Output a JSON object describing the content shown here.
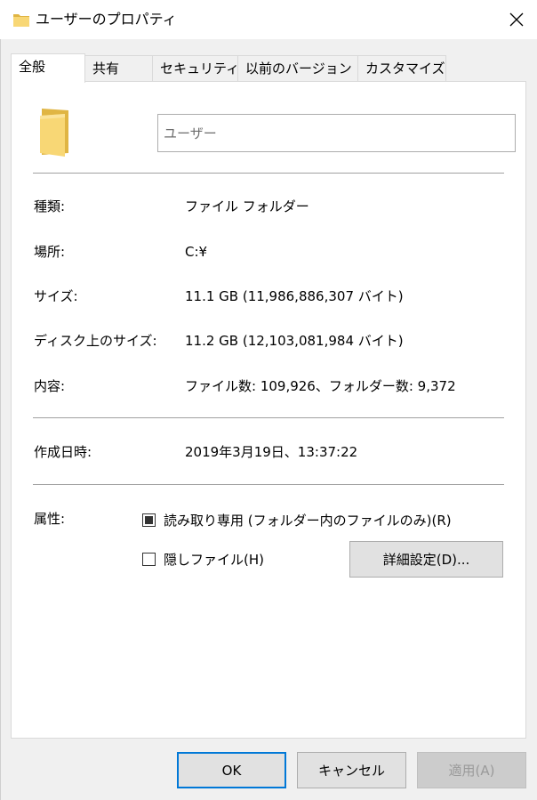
{
  "window": {
    "title": "ユーザーのプロパティ",
    "title_icon": "folder-icon",
    "close_icon": "close-icon"
  },
  "tabs": [
    {
      "label": "全般",
      "active": true
    },
    {
      "label": "共有",
      "active": false
    },
    {
      "label": "セキュリティ",
      "active": false
    },
    {
      "label": "以前のバージョン",
      "active": false
    },
    {
      "label": "カスタマイズ",
      "active": false
    }
  ],
  "general": {
    "folder_icon": "folder-icon",
    "name_placeholder": "ユーザー",
    "rows": [
      {
        "label": "種類:",
        "value": "ファイル フォルダー"
      },
      {
        "label": "場所:",
        "value": "C:¥"
      },
      {
        "label": "サイズ:",
        "value": "11.1 GB (11,986,886,307 バイト)"
      },
      {
        "label": "ディスク上のサイズ:",
        "value": "11.2 GB (12,103,081,984 バイト)"
      },
      {
        "label": "内容:",
        "value": "ファイル数: 109,926、フォルダー数: 9,372"
      }
    ],
    "created_label": "作成日時:",
    "created_value": "2019年3月19日、13:37:22",
    "attributes_label": "属性:",
    "readonly_label": "読み取り専用 (フォルダー内のファイルのみ)(R)",
    "hidden_label": "隠しファイル(H)",
    "advanced_button": "詳細設定(D)..."
  },
  "footer": {
    "ok": "OK",
    "cancel": "キャンセル",
    "apply": "適用(A)"
  },
  "colors": {
    "folder_yellow": "#f8d775",
    "folder_dark": "#e0b543",
    "accent": "#0078d7"
  }
}
